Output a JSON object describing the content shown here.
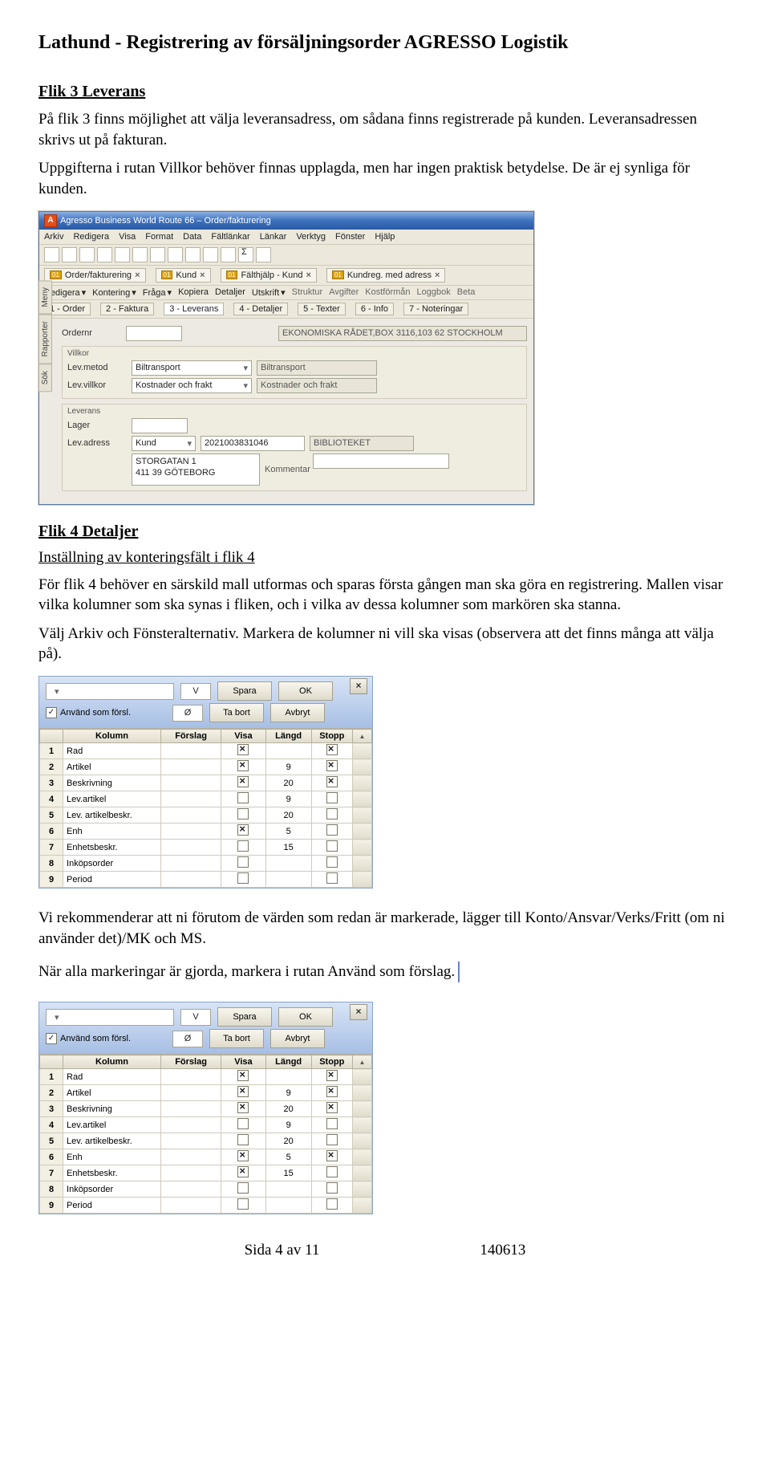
{
  "title": "Lathund - Registrering av försäljningsorder AGRESSO Logistik",
  "sec1": {
    "heading": "Flik 3 Leverans",
    "p1": "På flik 3 finns möjlighet att välja leveransadress, om sådana finns registrerade på kunden. Leveransadressen skrivs ut på fakturan.",
    "p2": "Uppgifterna i rutan Villkor behöver finnas upplagda, men har ingen praktisk betydelse. De är ej synliga för kunden."
  },
  "agresso": {
    "titlebar": "Agresso Business World Route 66 – Order/fakturering",
    "menus": [
      "Arkiv",
      "Redigera",
      "Visa",
      "Format",
      "Data",
      "Fältlänkar",
      "Länkar",
      "Verktyg",
      "Fönster",
      "Hjälp"
    ],
    "sidetabs": [
      "Meny",
      "Rapporter",
      "Sök"
    ],
    "opentabs": [
      "Order/fakturering",
      "Kund",
      "Fälthjälp - Kund",
      "Kundreg. med adress"
    ],
    "subtabs": [
      "Redigera",
      "Kontering",
      "Fråga",
      "Kopiera",
      "Detaljer",
      "Utskrift",
      "Struktur",
      "Avgifter",
      "Kostförmån",
      "Loggbok",
      "Beta"
    ],
    "formtabs": [
      "1 - Order",
      "2 - Faktura",
      "3 - Leverans",
      "4 - Detaljer",
      "5 - Texter",
      "6 - Info",
      "7 - Noteringar"
    ],
    "ordernr_label": "Ordernr",
    "ordernr_right": "EKONOMISKA RÅDET,BOX 3116,103 62 STOCKHOLM",
    "villkor": {
      "group": "Villkor",
      "levmetod_label": "Lev.metod",
      "levmetod_val": "Biltransport",
      "levmetod_right": "Biltransport",
      "levvillkor_label": "Lev.villkor",
      "levvillkor_val": "Kostnader och frakt",
      "levvillkor_right": "Kostnader och frakt"
    },
    "leverans": {
      "group": "Leverans",
      "lager_label": "Lager",
      "levadress_label": "Lev.adress",
      "levadress_type": "Kund",
      "levadress_code": "2021003831046",
      "levadress_name": "BIBLIOTEKET",
      "addr_lines": "STORGATAN 1\n411 39 GÖTEBORG",
      "kommentar_label": "Kommentar"
    }
  },
  "sec2": {
    "heading": "Flik 4 Detaljer",
    "subheading": "Inställning av konteringsfält i flik 4",
    "p1": "För flik 4 behöver en särskild mall utformas och sparas första gången man ska göra en registrering. Mallen visar vilka kolumner som ska synas i fliken, och i vilka av dessa kolumner som markören ska stanna.",
    "p2": "Välj Arkiv och Fönsteralternativ. Markera de kolumner ni vill ska visas (observera att det finns många att välja på)."
  },
  "dialog": {
    "checkbox_label": "Använd som försl.",
    "v_label": "V",
    "o_label": "Ø",
    "btn_spara": "Spara",
    "btn_ok": "OK",
    "btn_tabort": "Ta bort",
    "btn_avbryt": "Avbryt",
    "headers": [
      "",
      "Kolumn",
      "Förslag",
      "Visa",
      "Längd",
      "Stopp"
    ],
    "rows1": [
      {
        "n": "1",
        "kol": "Rad",
        "for": "",
        "visa": true,
        "len": "",
        "stopp": true
      },
      {
        "n": "2",
        "kol": "Artikel",
        "for": "",
        "visa": true,
        "len": "9",
        "stopp": true
      },
      {
        "n": "3",
        "kol": "Beskrivning",
        "for": "",
        "visa": true,
        "len": "20",
        "stopp": true
      },
      {
        "n": "4",
        "kol": "Lev.artikel",
        "for": "",
        "visa": false,
        "len": "9",
        "stopp": false
      },
      {
        "n": "5",
        "kol": "Lev. artikelbeskr.",
        "for": "",
        "visa": false,
        "len": "20",
        "stopp": false
      },
      {
        "n": "6",
        "kol": "Enh",
        "for": "",
        "visa": true,
        "len": "5",
        "stopp": false
      },
      {
        "n": "7",
        "kol": "Enhetsbeskr.",
        "for": "",
        "visa": false,
        "len": "15",
        "stopp": false
      },
      {
        "n": "8",
        "kol": "Inköpsorder",
        "for": "",
        "visa": false,
        "len": "",
        "stopp": false
      },
      {
        "n": "9",
        "kol": "Period",
        "for": "",
        "visa": false,
        "len": "",
        "stopp": false
      }
    ],
    "rows2": [
      {
        "n": "1",
        "kol": "Rad",
        "for": "",
        "visa": true,
        "len": "",
        "stopp": true
      },
      {
        "n": "2",
        "kol": "Artikel",
        "for": "",
        "visa": true,
        "len": "9",
        "stopp": true
      },
      {
        "n": "3",
        "kol": "Beskrivning",
        "for": "",
        "visa": true,
        "len": "20",
        "stopp": true
      },
      {
        "n": "4",
        "kol": "Lev.artikel",
        "for": "",
        "visa": false,
        "len": "9",
        "stopp": false
      },
      {
        "n": "5",
        "kol": "Lev. artikelbeskr.",
        "for": "",
        "visa": false,
        "len": "20",
        "stopp": false
      },
      {
        "n": "6",
        "kol": "Enh",
        "for": "",
        "visa": true,
        "len": "5",
        "stopp": true
      },
      {
        "n": "7",
        "kol": "Enhetsbeskr.",
        "for": "",
        "visa": true,
        "len": "15",
        "stopp": false
      },
      {
        "n": "8",
        "kol": "Inköpsorder",
        "for": "",
        "visa": false,
        "len": "",
        "stopp": false
      },
      {
        "n": "9",
        "kol": "Period",
        "for": "",
        "visa": false,
        "len": "",
        "stopp": false
      }
    ]
  },
  "sec3": {
    "p1": "Vi rekommenderar att ni förutom de värden som redan är markerade, lägger till Konto/Ansvar/Verks/Fritt (om ni använder det)/MK och MS.",
    "p2": "När alla markeringar är gjorda, markera i rutan Använd som förslag."
  },
  "footer": {
    "page": "Sida 4 av 11",
    "date": "140613"
  }
}
